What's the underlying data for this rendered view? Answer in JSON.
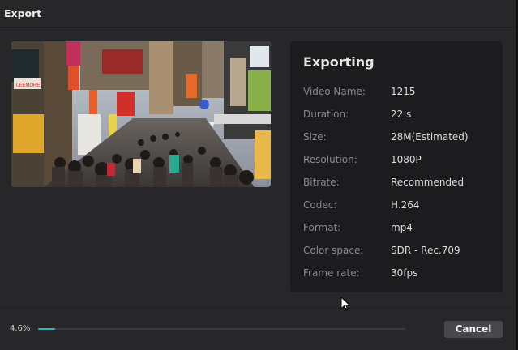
{
  "window": {
    "title": "Export"
  },
  "preview": {
    "image": "city-street-preview-thumbnail",
    "shop_sign": "LEEMORE"
  },
  "info": {
    "heading": "Exporting",
    "rows": [
      {
        "label": "Video Name:",
        "value": "1215"
      },
      {
        "label": "Duration:",
        "value": "22 s"
      },
      {
        "label": "Size:",
        "value": "28M(Estimated)"
      },
      {
        "label": "Resolution:",
        "value": "1080P"
      },
      {
        "label": "Bitrate:",
        "value": "Recommended"
      },
      {
        "label": "Codec:",
        "value": "H.264"
      },
      {
        "label": "Format:",
        "value": "mp4"
      },
      {
        "label": "Color space:",
        "value": "SDR - Rec.709"
      },
      {
        "label": "Frame rate:",
        "value": "30fps"
      }
    ]
  },
  "progress": {
    "label": "4.6%",
    "fraction": 0.046
  },
  "buttons": {
    "cancel": "Cancel"
  },
  "colors": {
    "background": "#27272a",
    "panel": "#1c1c1e",
    "accent": "#27b6c9",
    "button": "#48484c"
  },
  "icons": {
    "cursor": "arrow-pointer-icon"
  }
}
